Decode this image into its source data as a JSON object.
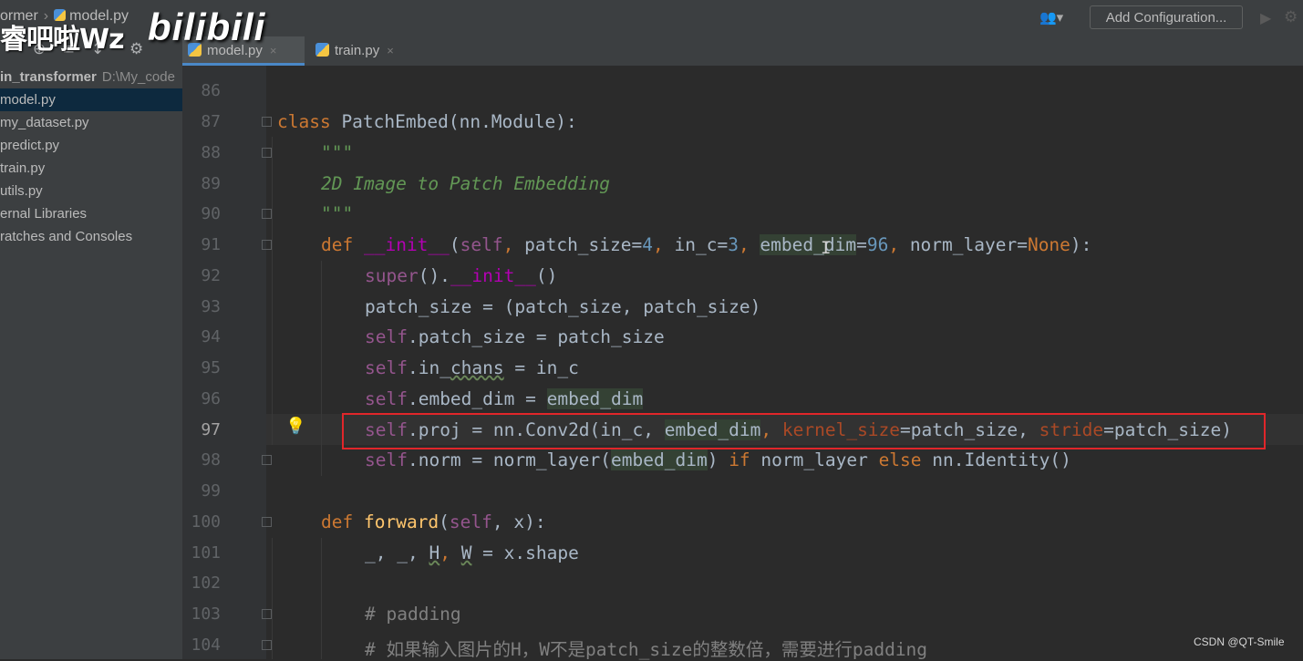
{
  "topbar": {
    "breadcrumb_project": "ormer",
    "breadcrumb_file": "model.py",
    "vcs_icon": "user-group-icon",
    "add_configuration": "Add Configuration...",
    "run_icon": "play-icon",
    "debug_icon": "bug-icon"
  },
  "watermark_top": {
    "cjk": "睿吧啦Wz",
    "bilibili": "bilibili"
  },
  "tabs": [
    {
      "label": "model.py",
      "active": true
    },
    {
      "label": "train.py",
      "active": false
    }
  ],
  "tab_close": "×",
  "project_tree": {
    "root": "in_transformer",
    "root_path": "D:\\My_code",
    "items": [
      "model.py",
      "my_dataset.py",
      "predict.py",
      "train.py",
      "utils.py"
    ],
    "external_libraries": "ernal Libraries",
    "scratches": "ratches and Consoles"
  },
  "line_numbers": [
    "86",
    "87",
    "88",
    "89",
    "90",
    "91",
    "92",
    "93",
    "94",
    "95",
    "96",
    "97",
    "98",
    "99",
    "100",
    "101",
    "102",
    "103",
    "104"
  ],
  "current_line": "97",
  "code": {
    "l87_class": "class",
    "l87_rest": " PatchEmbed(nn.Module):",
    "l88": "\"\"\"",
    "l89": "2D Image to Patch Embedding",
    "l90": "\"\"\"",
    "l91_def": "def",
    "l91_name": "__init__",
    "l91_open": "(",
    "l91_self": "self",
    "l91_c1": ", ",
    "l91_p1": "patch_size=",
    "l91_v1": "4",
    "l91_c2": ", ",
    "l91_p2": "in_c=",
    "l91_v2": "3",
    "l91_c3": ", ",
    "l91_p3": "embed_dim",
    "l91_eq": "=",
    "l91_v3": "96",
    "l91_c4": ", ",
    "l91_p4": "norm_layer=",
    "l91_v4": "None",
    "l91_close": "):",
    "l92_super": "super",
    "l92_mid": "().",
    "l92_init": "__init__",
    "l92_end": "()",
    "l93": "patch_size = (patch_size, patch_size)",
    "l94_self": "self",
    "l94_rest": ".patch_size = patch_size",
    "l95_self": "self",
    "l95_a": ".in_",
    "l95_b": "chans",
    "l95_c": " = in_c",
    "l96_self": "self",
    "l96_a": ".embed_dim = ",
    "l96_b": "embed_dim",
    "l97_self": "self",
    "l97_a": ".proj = nn.Conv2d(in_c, ",
    "l97_b": "embed_dim",
    "l97_c": ", ",
    "l97_k": "kernel_size",
    "l97_d": "=patch_size, ",
    "l97_s": "stride",
    "l97_e": "=patch_size)",
    "l98_self": "self",
    "l98_a": ".norm = norm_layer(",
    "l98_b": "embed_dim",
    "l98_c": ") ",
    "l98_if": "if",
    "l98_d": " norm_layer ",
    "l98_else": "else",
    "l98_e": " nn.Identity()",
    "l100_def": "def",
    "l100_name": "forward",
    "l100_open": "(",
    "l100_self": "self",
    "l100_rest": ", x):",
    "l101_a": "_, _, ",
    "l101_H": "H",
    "l101_c": ", ",
    "l101_W": "W",
    "l101_d": " = x.shape",
    "l103": "# padding",
    "l104": "# 如果输入图片的H，W不是patch_size的整数倍，需要进行padding"
  },
  "bulb_icon": "lightbulb-icon",
  "csdn_watermark": "CSDN @QT-Smile"
}
